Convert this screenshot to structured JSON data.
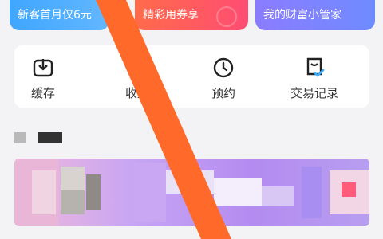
{
  "promos": [
    {
      "text": "新客首月仅6元",
      "color": "#4aa8ff"
    },
    {
      "text": "精彩用券享",
      "color": "#ff5d5d"
    },
    {
      "text": "我的财富小管家",
      "color": "#7d84ff"
    }
  ],
  "actions": [
    {
      "label": "缓存",
      "icon": "download-icon"
    },
    {
      "label": "收益",
      "icon": "earnings-icon"
    },
    {
      "label": "预约",
      "icon": "clock-icon"
    },
    {
      "label": "交易记录",
      "icon": "trade-record-icon"
    }
  ],
  "colors": {
    "orange_mark": "#ff6a2a",
    "icon_stroke": "#222222",
    "check_accent": "#3ab0ff"
  }
}
